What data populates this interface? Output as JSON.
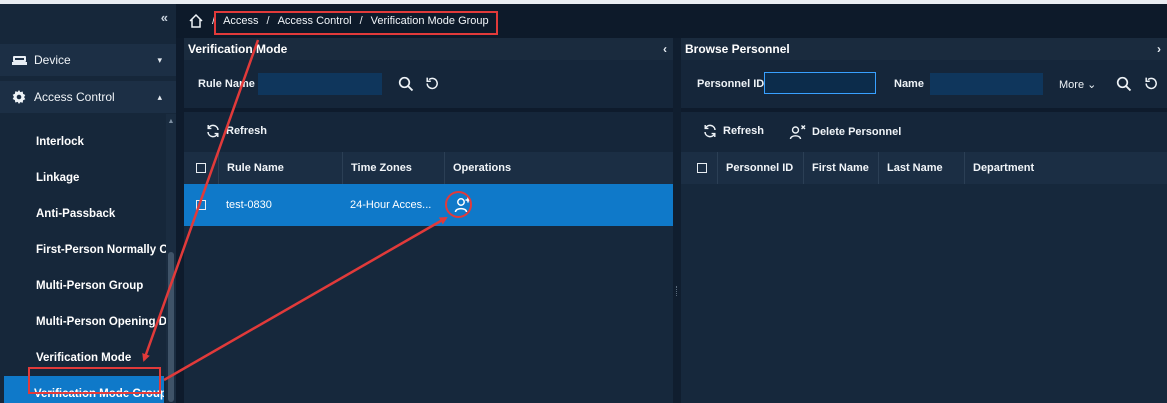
{
  "colors": {
    "accent": "#0f79c9",
    "annotation": "#e13a3a"
  },
  "sidebar": {
    "collapse_icon": "double-chevron-left-icon",
    "collapse_glyph": "«",
    "groups": {
      "device": {
        "label": "Device",
        "icon": "device-icon",
        "caret": "▾"
      },
      "access_control": {
        "label": "Access Control",
        "icon": "gear-icon",
        "caret": "▴"
      }
    },
    "items": [
      {
        "label": "Interlock"
      },
      {
        "label": "Linkage"
      },
      {
        "label": "Anti-Passback"
      },
      {
        "label": "First-Person Normally Open"
      },
      {
        "label": "Multi-Person Group"
      },
      {
        "label": "Multi-Person Opening Door"
      },
      {
        "label": "Verification Mode"
      },
      {
        "label": "Verification Mode Group",
        "active": true
      }
    ]
  },
  "breadcrumb": {
    "separator": "/",
    "items": [
      "Access",
      "Access Control",
      "Verification Mode Group"
    ]
  },
  "left_panel": {
    "title": "Verification Mode",
    "collapse_glyph": "‹",
    "search": {
      "label": "Rule Name",
      "value": "",
      "placeholder": ""
    },
    "toolbar": {
      "refresh_label": "Refresh"
    },
    "columns": [
      "Rule Name",
      "Time Zones",
      "Operations"
    ],
    "rows": [
      {
        "rule_name": "test-0830",
        "time_zones": "24-Hour Acces...",
        "selected": true,
        "operation_icon": "add-person-icon"
      }
    ]
  },
  "right_panel": {
    "title": "Browse Personnel",
    "expand_glyph": "›",
    "search": {
      "personnel_id_label": "Personnel ID",
      "personnel_id_value": "",
      "name_label": "Name",
      "name_value": "",
      "more_label": "More",
      "more_caret": "⌄"
    },
    "toolbar": {
      "refresh_label": "Refresh",
      "delete_label": "Delete Personnel"
    },
    "columns": [
      "Personnel ID",
      "First Name",
      "Last Name",
      "Department"
    ],
    "rows": []
  }
}
